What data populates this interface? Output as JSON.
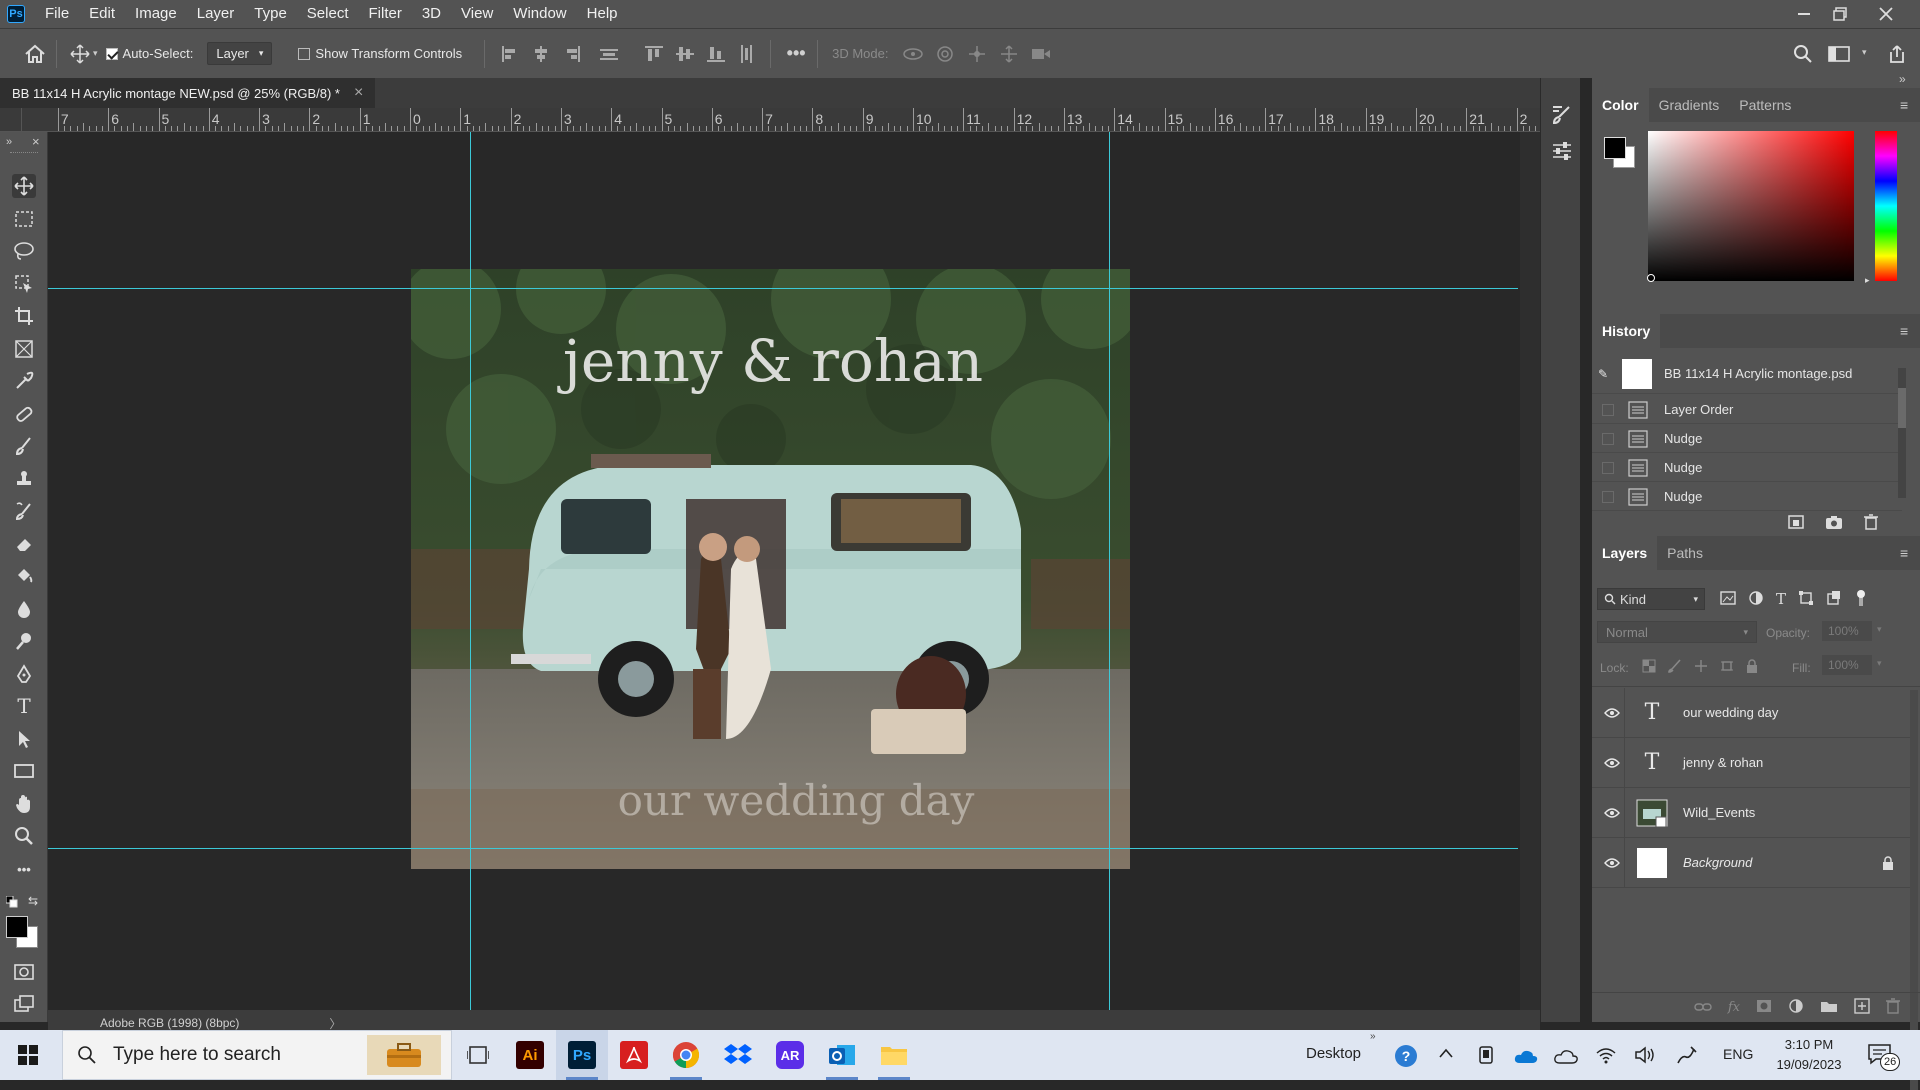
{
  "app": {
    "logo": "Ps"
  },
  "menu": [
    "File",
    "Edit",
    "Image",
    "Layer",
    "Type",
    "Select",
    "Filter",
    "3D",
    "View",
    "Window",
    "Help"
  ],
  "options": {
    "auto_select_label": "Auto-Select:",
    "auto_select_value": "Layer",
    "transform_label": "Show Transform Controls",
    "mode3d_label": "3D Mode:"
  },
  "document": {
    "tab_title": "BB 11x14 H Acrylic montage NEW.psd @ 25% (RGB/8) *",
    "close": "×"
  },
  "ruler": {
    "labels": [
      "7",
      "6",
      "5",
      "4",
      "3",
      "2",
      "1",
      "0",
      "1",
      "2",
      "3",
      "4",
      "5",
      "6",
      "7",
      "8",
      "9",
      "10",
      "11",
      "12",
      "13",
      "14",
      "15",
      "16",
      "17",
      "18",
      "19",
      "20",
      "21",
      "2"
    ]
  },
  "canvas": {
    "title_text": "jenny & rohan",
    "subtitle_text": "our wedding day"
  },
  "status": {
    "profile": "Adobe RGB (1998) (8bpc)",
    "arrow": "〉"
  },
  "color_panel": {
    "tabs": [
      "Color",
      "Gradients",
      "Patterns"
    ],
    "fg": "#000000",
    "bg": "#ffffff",
    "hue": "#ff0000"
  },
  "history_panel": {
    "title": "History",
    "snapshot": "BB 11x14 H Acrylic montage.psd",
    "steps": [
      "Layer Order",
      "Nudge",
      "Nudge",
      "Nudge"
    ]
  },
  "layers_panel": {
    "tabs": [
      "Layers",
      "Paths"
    ],
    "kind_label": "Kind",
    "blend_mode": "Normal",
    "opacity_label": "Opacity:",
    "opacity_value": "100%",
    "lock_label": "Lock:",
    "fill_label": "Fill:",
    "fill_value": "100%",
    "layers": [
      {
        "name": "our wedding day",
        "type": "text"
      },
      {
        "name": "jenny & rohan",
        "type": "text"
      },
      {
        "name": "Wild_Events",
        "type": "smart-object"
      },
      {
        "name": "Background",
        "type": "background"
      }
    ]
  },
  "taskbar": {
    "search_placeholder": "Type here to search",
    "desktop_label": "Desktop",
    "lang": "ENG",
    "time": "3:10 PM",
    "date": "19/09/2023",
    "notification_count": "26"
  },
  "colors": {
    "guide": "#3cc9d7",
    "ui_dark": "#282828",
    "ui_panel": "#535353",
    "ps_blue": "#31a8ff"
  }
}
